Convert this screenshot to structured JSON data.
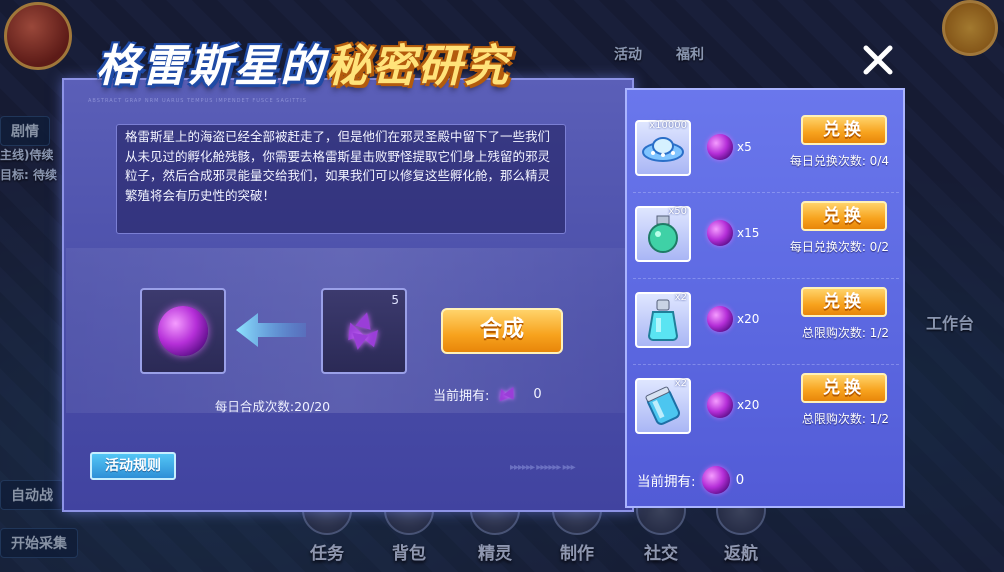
{
  "background": {
    "top_labels": [
      "活动",
      "福利"
    ],
    "side_buttons": [
      "剧情",
      "主线)侍续",
      "目标: 待续",
      "自动战",
      "开始采集"
    ],
    "right_label": "工作台",
    "bottom_nav": [
      "任务",
      "背包",
      "精灵",
      "制作",
      "社交",
      "返航"
    ]
  },
  "modal": {
    "title_part1": "格雷斯星的",
    "title_part2": "秘密研究",
    "deco_text": "ABSTRACT GRAP                                                                      NRM UARUS TEMPUS IMPENDET FUSCE SAGITTIS",
    "story": "格雷斯星上的海盗已经全部被赶走了，但是他们在邪灵圣殿中留下了一些我们从未见过的孵化舱残骸，你需要去格雷斯星击败野怪提取它们身上残留的邪灵粒子，然后合成邪灵能量交给我们，如果我们可以修复这些孵化舱，那么精灵繁殖将会有历史性的突破！",
    "source_count": "5",
    "synth_button": "合成",
    "synth_limit": "每日合成次数:20/20",
    "owned_label": "当前拥有:",
    "owned_value": "0",
    "rules_button": "活动规则",
    "deco_arrows": "▸▸▸▸▸▸ ▸▸▸▸▸▸ ▸▸▸"
  },
  "exchange": {
    "items": [
      {
        "tag": "x10000",
        "cost": "x5",
        "button": "兑换",
        "limit": "每日兑换次数: 0/4",
        "icon": "ufo-icon"
      },
      {
        "tag": "x50",
        "cost": "x15",
        "button": "兑换",
        "limit": "每日兑换次数: 0/2",
        "icon": "green-potion-icon"
      },
      {
        "tag": "x2",
        "cost": "x20",
        "button": "兑换",
        "limit": "总限购次数: 1/2",
        "icon": "cyan-bottle-icon"
      },
      {
        "tag": "x2",
        "cost": "x20",
        "button": "兑换",
        "limit": "总限购次数: 1/2",
        "icon": "blue-jar-icon"
      }
    ],
    "owned_label": "当前拥有:",
    "owned_value": "0"
  },
  "colors": {
    "accent_orange": "#f7a21d",
    "panel_purple": "#4a4ea8",
    "panel_blue": "#5b67e0",
    "orb_purple": "#b52fd8"
  }
}
